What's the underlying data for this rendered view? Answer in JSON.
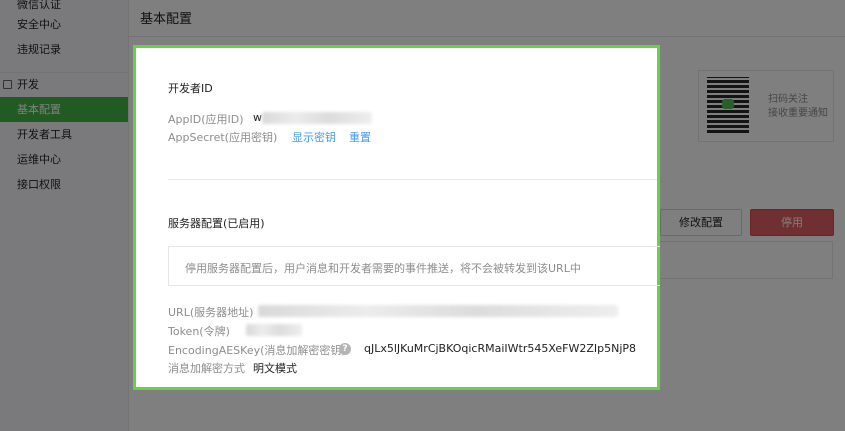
{
  "sidebar": {
    "items": [
      {
        "label": "微信认证"
      },
      {
        "label": "安全中心"
      },
      {
        "label": "违规记录"
      }
    ],
    "group": {
      "label": "开发",
      "icon": "developer-icon"
    },
    "dev_items": [
      {
        "label": "基本配置",
        "active": true
      },
      {
        "label": "开发者工具"
      },
      {
        "label": "运维中心"
      },
      {
        "label": "接口权限"
      }
    ]
  },
  "main": {
    "title": "基本配置",
    "qr": {
      "line1": "扫码关注",
      "line2": "接收重要通知",
      "icon": "qr-code-icon"
    },
    "edit_button": "修改配置",
    "stop_button": "停用"
  },
  "dialog": {
    "developer_title": "开发者ID",
    "appid_label": "AppID(应用ID)",
    "appid_value": "w",
    "appsecret_label": "AppSecret(应用密钥)",
    "show_secret": "显示密钥",
    "reset": "重置",
    "server_title": "服务器配置(已启用)",
    "notice": "停用服务器配置后，用户消息和开发者需要的事件推送，将不会被转发到该URL中",
    "url_label": "URL(服务器地址)",
    "token_label": "Token(令牌)",
    "aeskey_label": "EncodingAESKey(消息加解密密钥)",
    "help_glyph": "?",
    "aeskey_value": "qJLx5lJKuMrCjBKOqicRMaiIWtr545XeFW2ZIp5NjP8",
    "encrypt_label": "消息加解密方式",
    "encrypt_value": "明文模式"
  },
  "colors": {
    "accent_green": "#44b549",
    "dialog_border": "#6ad04a",
    "link_blue": "#459ae9",
    "danger_red": "#e15f63"
  }
}
